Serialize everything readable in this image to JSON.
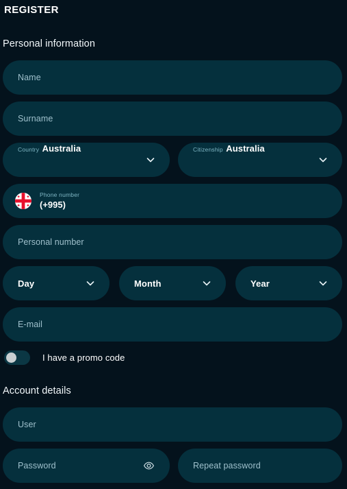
{
  "header": {
    "title": "REGISTER"
  },
  "sections": {
    "personal": "Personal information",
    "account": "Account details"
  },
  "personal": {
    "name_placeholder": "Name",
    "surname_placeholder": "Surname",
    "country": {
      "label": "Country",
      "value": "Australia"
    },
    "citizenship": {
      "label": "Citizenship",
      "value": "Australia"
    },
    "phone": {
      "label": "Phone number",
      "value": "(+995)",
      "flag": "georgia-flag-icon"
    },
    "personal_number_placeholder": "Personal number",
    "birthdate": {
      "day": "Day",
      "month": "Month",
      "year": "Year"
    },
    "email_placeholder": "E-mail",
    "promo": {
      "label": "I have a promo code",
      "enabled": false
    }
  },
  "account": {
    "user_placeholder": "User",
    "password_placeholder": "Password",
    "repeat_password_placeholder": "Repeat password"
  },
  "icons": {
    "chevron": "chevron-down-icon",
    "eye": "eye-icon"
  },
  "colors": {
    "background": "#04121c",
    "field": "#05303d",
    "placeholder": "#9fc0cc",
    "label": "#7fb6c4",
    "text": "#ffffff",
    "toggle_track": "#0b3744",
    "toggle_knob": "#c9cfd2"
  }
}
